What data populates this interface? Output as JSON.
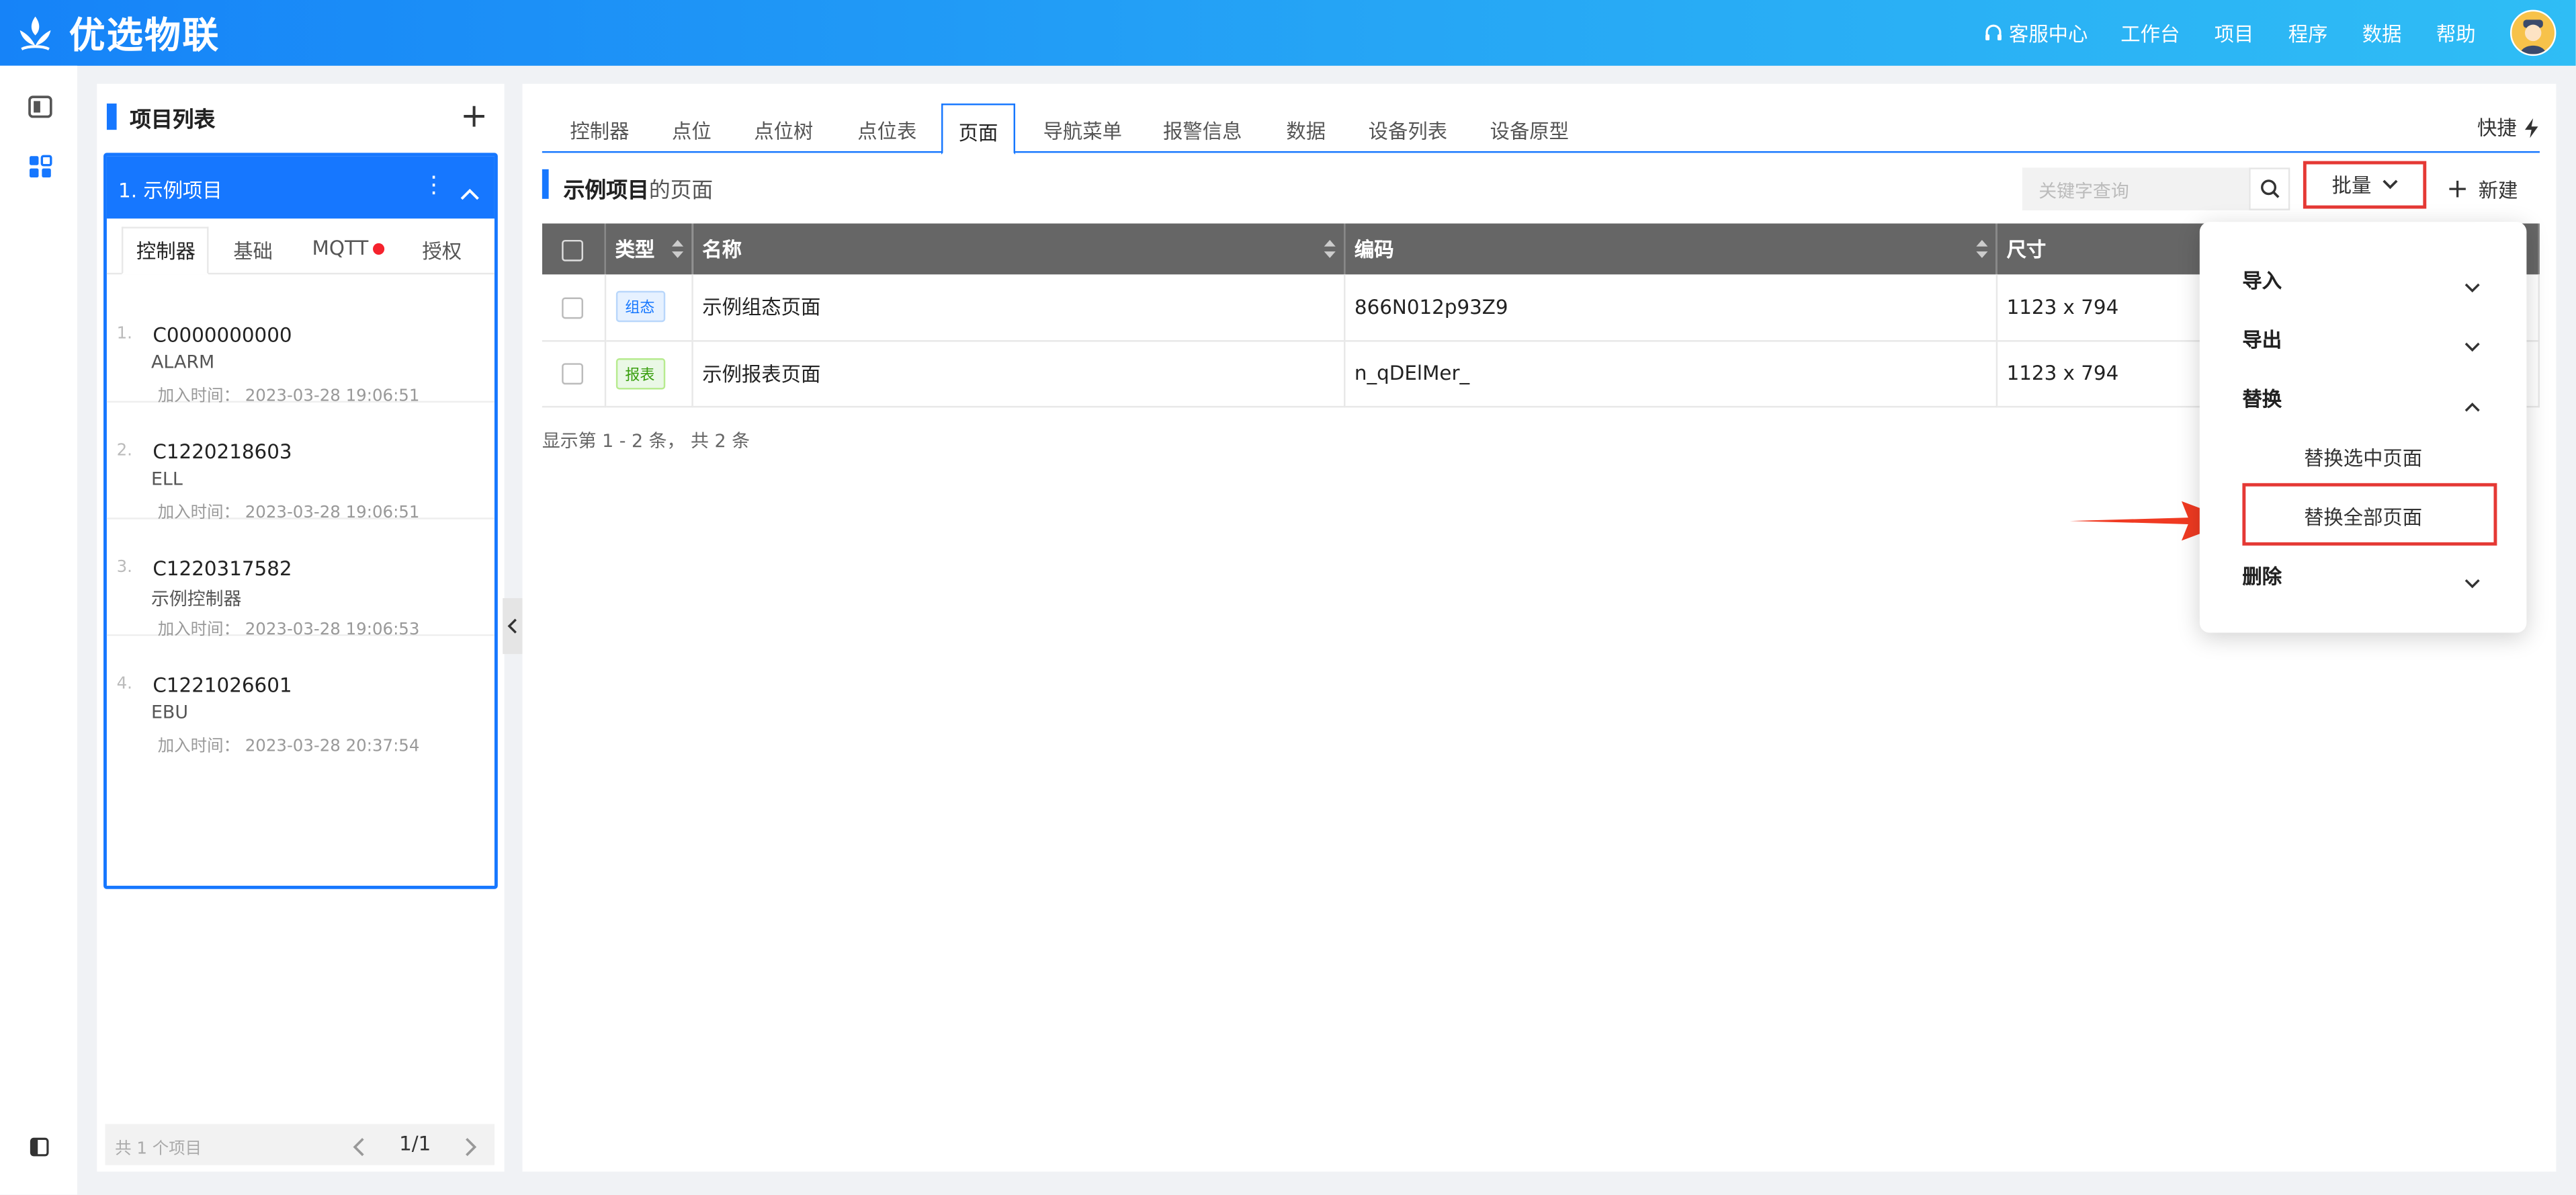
{
  "header": {
    "logo_text": "优选物联",
    "service_label": "客服中心",
    "nav": [
      "工作台",
      "项目",
      "程序",
      "数据",
      "帮助"
    ]
  },
  "projects": {
    "title": "项目列表",
    "add_label": "+",
    "current_project": "1. 示例项目",
    "tabs": [
      "控制器",
      "基础",
      "MQTT",
      "授权"
    ],
    "controllers": [
      {
        "idx": "1.",
        "code": "C0000000000",
        "name": "ALARM",
        "time": "加入时间： 2023-03-28 19:06:51"
      },
      {
        "idx": "2.",
        "code": "C1220218603",
        "name": "ELL",
        "time": "加入时间： 2023-03-28 19:06:51"
      },
      {
        "idx": "3.",
        "code": "C1220317582",
        "name": "示例控制器",
        "time": "加入时间： 2023-03-28 19:06:53"
      },
      {
        "idx": "4.",
        "code": "C1221026601",
        "name": "EBU",
        "time": "加入时间： 2023-03-28 20:37:54"
      }
    ],
    "footer_count": "共 1 个项目",
    "page": "1/1"
  },
  "main": {
    "tabs": [
      "控制器",
      "点位",
      "点位树",
      "点位表",
      "页面",
      "导航菜单",
      "报警信息",
      "数据",
      "设备列表",
      "设备原型"
    ],
    "active_tab": "页面",
    "quick_label": "快捷",
    "section_project": "示例项目",
    "section_suffix": "的页面",
    "search_placeholder": "关键字查询",
    "batch_label": "批量",
    "new_label": "新建",
    "table": {
      "headers": [
        "类型",
        "名称",
        "编码",
        "尺寸"
      ],
      "rows": [
        {
          "type": "组态",
          "name": "示例组态页面",
          "code": "866N012p93Z9",
          "size": "1123 x 794"
        },
        {
          "type": "报表",
          "name": "示例报表页面",
          "code": "n_qDElMer_",
          "size": "1123 x 794"
        }
      ]
    },
    "summary": "显示第 1 - 2 条， 共 2 条"
  },
  "dropdown": {
    "import": "导入",
    "export": "导出",
    "replace": "替换",
    "replace_selected": "替换选中页面",
    "replace_all": "替换全部页面",
    "delete": "删除"
  },
  "colors": {
    "accent": "#1677ff",
    "header_gradient_start": "#1683f8",
    "header_gradient_end": "#2fbdf5",
    "highlight_red": "#e53935"
  }
}
